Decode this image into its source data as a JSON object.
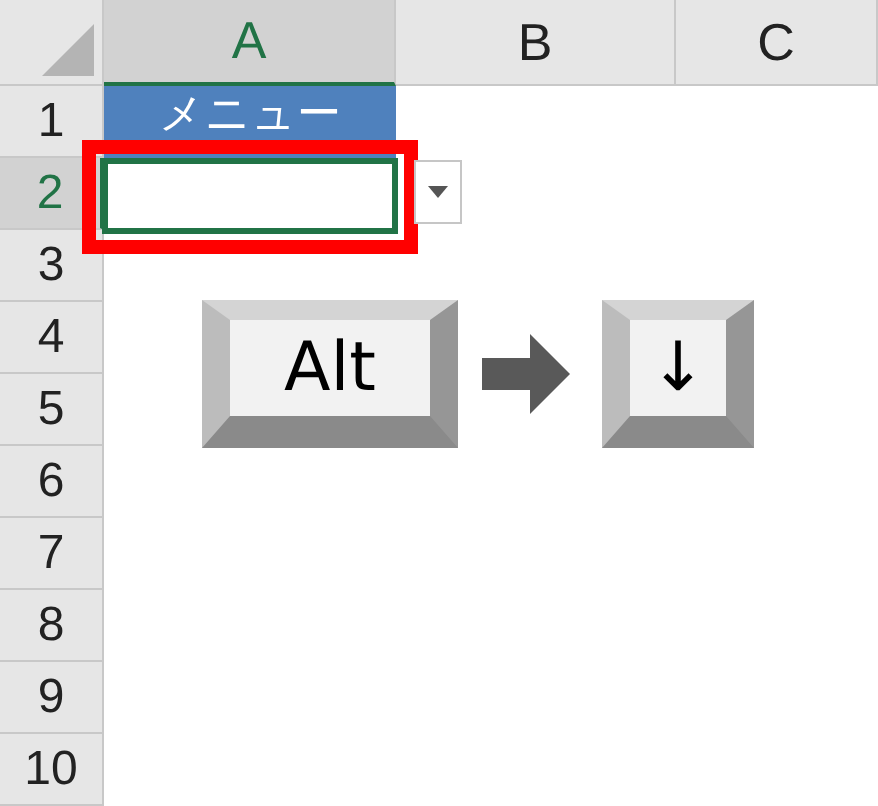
{
  "columns": [
    {
      "label": "A",
      "selected": true
    },
    {
      "label": "B",
      "selected": false
    },
    {
      "label": "C",
      "selected": false
    }
  ],
  "rows": [
    {
      "label": "1",
      "selected": false
    },
    {
      "label": "2",
      "selected": true
    },
    {
      "label": "3",
      "selected": false
    },
    {
      "label": "4",
      "selected": false
    },
    {
      "label": "5",
      "selected": false
    },
    {
      "label": "6",
      "selected": false
    },
    {
      "label": "7",
      "selected": false
    },
    {
      "label": "8",
      "selected": false
    },
    {
      "label": "9",
      "selected": false
    },
    {
      "label": "10",
      "selected": false
    }
  ],
  "cell_a1": "メニュー",
  "keys": [
    {
      "label": "Alt"
    },
    {
      "label": "↓"
    }
  ]
}
